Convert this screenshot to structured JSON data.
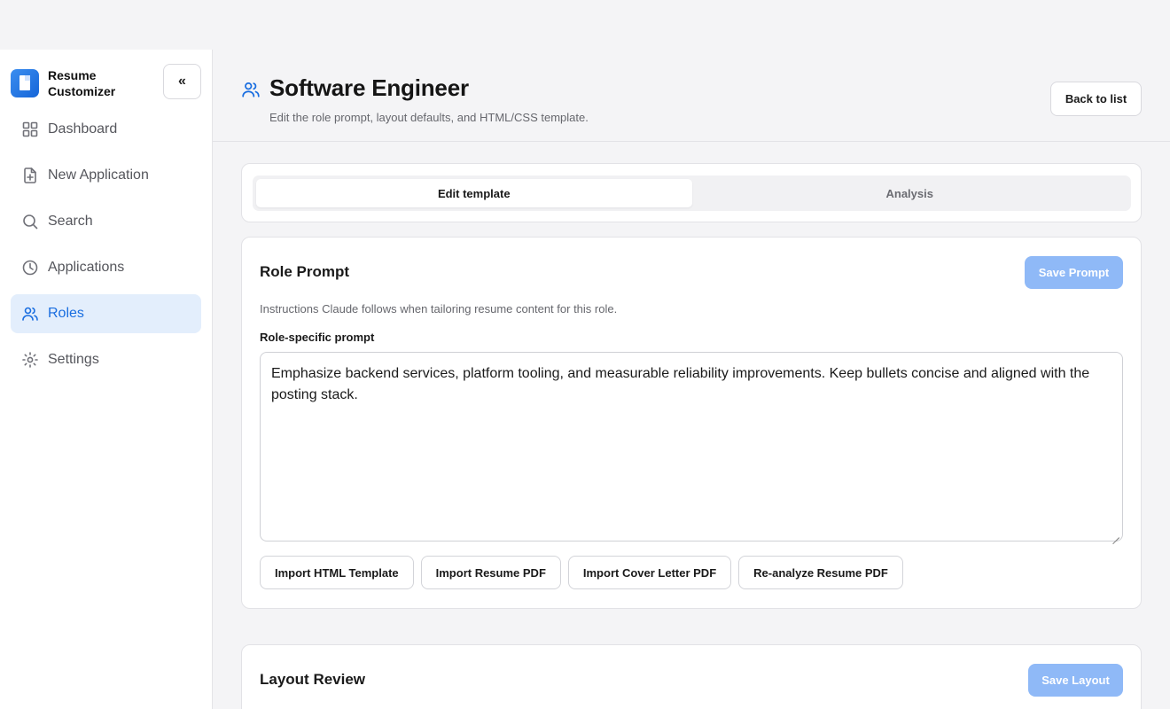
{
  "brand": {
    "name": "Resume Customizer",
    "collapse_label": "«"
  },
  "nav": {
    "items": [
      {
        "label": "Dashboard",
        "icon": "grid-icon"
      },
      {
        "label": "New Application",
        "icon": "file-plus-icon"
      },
      {
        "label": "Search",
        "icon": "search-icon"
      },
      {
        "label": "Applications",
        "icon": "clock-icon"
      },
      {
        "label": "Roles",
        "icon": "users-icon",
        "active": true
      },
      {
        "label": "Settings",
        "icon": "gear-icon"
      }
    ]
  },
  "header": {
    "title": "Software Engineer",
    "subtitle": "Edit the role prompt, layout defaults, and HTML/CSS template.",
    "back_label": "Back to list"
  },
  "tabs": [
    {
      "label": "Edit template",
      "active": true
    },
    {
      "label": "Analysis",
      "active": false
    }
  ],
  "role_prompt": {
    "title": "Role Prompt",
    "save_label": "Save Prompt",
    "description": "Instructions Claude follows when tailoring resume content for this role.",
    "field_label": "Role-specific prompt",
    "value": "Emphasize backend services, platform tooling, and measurable reliability improvements. Keep bullets concise and aligned with the posting stack."
  },
  "import_buttons": [
    "Import HTML Template",
    "Import Resume PDF",
    "Import Cover Letter PDF",
    "Re-analyze Resume PDF"
  ],
  "layout_review": {
    "title": "Layout Review",
    "save_label": "Save Layout"
  },
  "colors": {
    "accent": "#1a6ee0",
    "active_nav_bg": "#e3eefc",
    "primary_disabled": "#8fb9f7"
  }
}
